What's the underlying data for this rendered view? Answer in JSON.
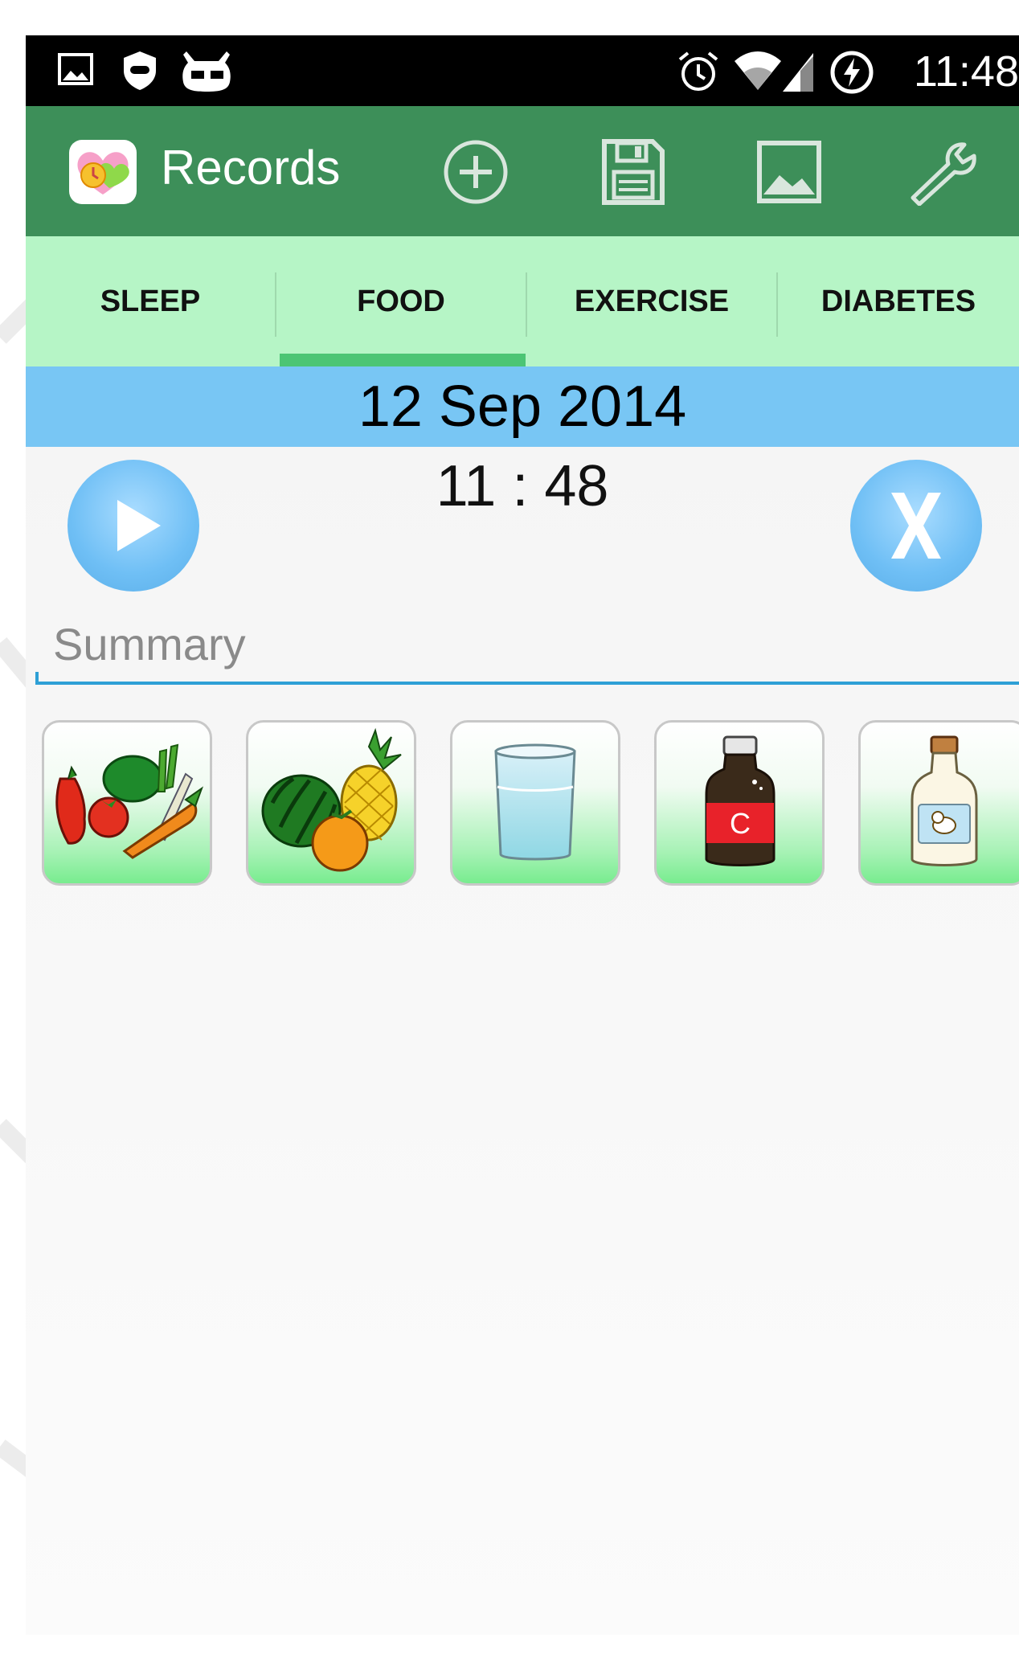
{
  "status_bar": {
    "time": "11:48",
    "left_icons": [
      "image-icon",
      "shield-icon",
      "cyanogen-icon"
    ],
    "right_icons": [
      "alarm-icon",
      "wifi-icon",
      "signal-icon",
      "battery-charging-icon"
    ]
  },
  "action_bar": {
    "title": "Records",
    "background": "#3d8f59",
    "actions": [
      "add-icon",
      "save-icon",
      "image-icon",
      "wrench-icon"
    ]
  },
  "tabs": [
    {
      "label": "SLEEP",
      "selected": false
    },
    {
      "label": "FOOD",
      "selected": true
    },
    {
      "label": "EXERCISE",
      "selected": false
    },
    {
      "label": "DIABETES",
      "selected": false
    }
  ],
  "date": "12 Sep 2014",
  "time": "11 : 48",
  "summary": {
    "placeholder": "Summary",
    "value": ""
  },
  "food_items": [
    {
      "icon": "vegetables-icon"
    },
    {
      "icon": "fruits-icon"
    },
    {
      "icon": "water-glass-icon"
    },
    {
      "icon": "cola-bottle-icon"
    },
    {
      "icon": "milk-bottle-icon"
    }
  ],
  "colors": {
    "tab_bar": "#b6f5c6",
    "tab_indicator": "#4cc574",
    "date_bar": "#78c6f4",
    "round_button": "#6fbff5"
  }
}
